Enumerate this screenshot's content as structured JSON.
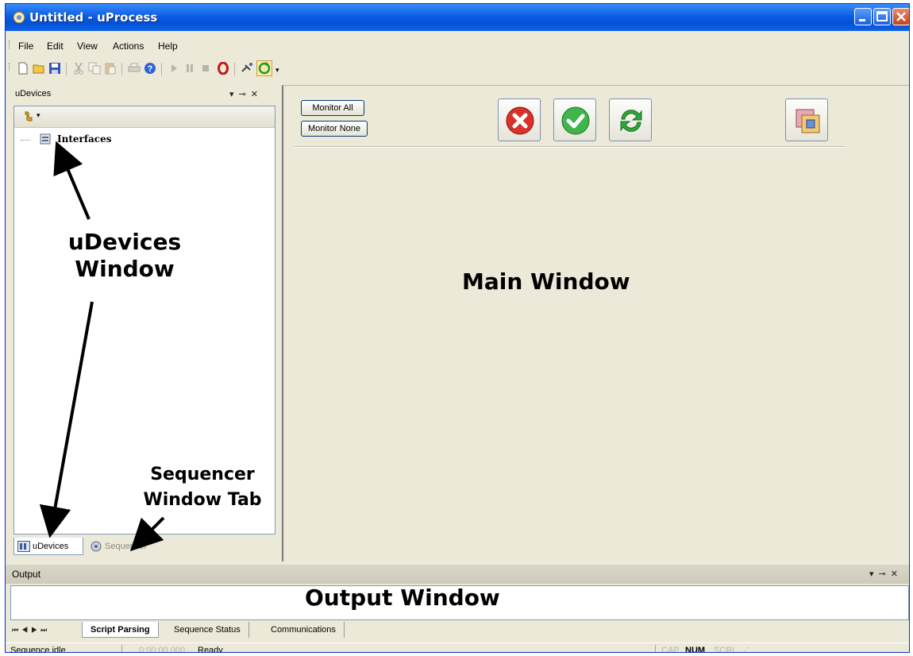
{
  "window": {
    "title": "Untitled - uProcess",
    "icon": "uprocess-logo-icon"
  },
  "menu": {
    "items": [
      "File",
      "Edit",
      "View",
      "Actions",
      "Help"
    ]
  },
  "toolbar": {
    "icons": [
      "new-file-icon",
      "open-folder-icon",
      "save-icon",
      "cut-icon",
      "copy-icon",
      "paste-icon",
      "print-icon",
      "help-icon",
      "play-icon",
      "pause-icon",
      "stop-icon",
      "record-icon",
      "connect-icon",
      "refresh-icon"
    ]
  },
  "udevices": {
    "header_label": "uDevices",
    "tree_item": "Interfaces",
    "tabs": [
      {
        "label": "uDevices",
        "active": true
      },
      {
        "label": "Sequencer",
        "active": false
      }
    ]
  },
  "main": {
    "monitor_all_label": "Monitor All",
    "monitor_none_label": "Monitor None",
    "buttons": [
      "cancel-icon",
      "ok-icon",
      "refresh-icon",
      "window-icon"
    ]
  },
  "annotations": {
    "udevices_line1": "uDevices",
    "udevices_line2": "Window",
    "sequencer_line1": "Sequencer",
    "sequencer_line2": "Window Tab",
    "main": "Main Window",
    "output": "Output Window"
  },
  "output": {
    "header_label": "Output",
    "tabs": [
      {
        "label": "Script Parsing",
        "active": true
      },
      {
        "label": "Sequence Status",
        "active": false
      },
      {
        "label": "Communications",
        "active": false
      }
    ]
  },
  "status": {
    "sequence": "Sequence idle",
    "time": "0:00:00.000",
    "state": "Ready",
    "cap": "CAP",
    "num": "NUM",
    "scrl": "SCRL"
  },
  "colors": {
    "title_bar": "#0a5ee6",
    "chrome": "#ece9d8",
    "panel_border": "#7f9db9"
  }
}
